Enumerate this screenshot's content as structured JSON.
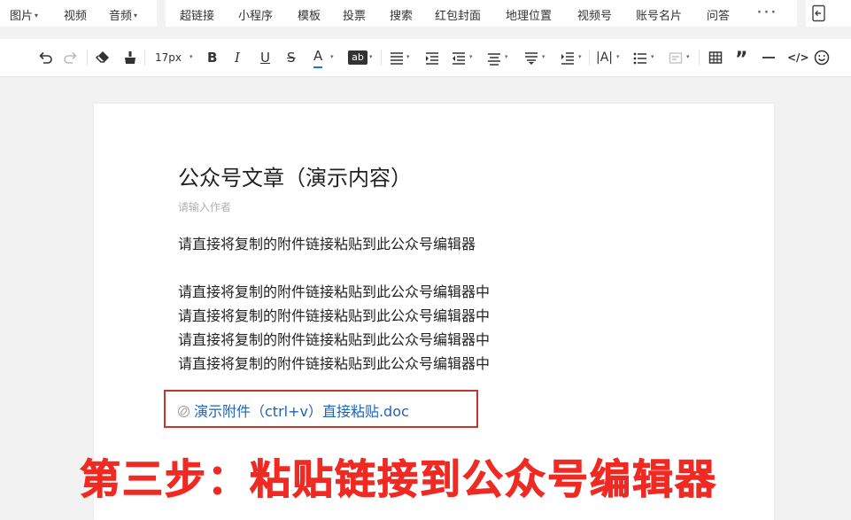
{
  "menubar": {
    "media": [
      {
        "label": "图片",
        "dropdown": true
      },
      {
        "label": "视频",
        "dropdown": false
      },
      {
        "label": "音频",
        "dropdown": true
      }
    ],
    "tools": [
      "超链接",
      "小程序",
      "模板",
      "投票",
      "搜索",
      "红包封面",
      "地理位置",
      "视频号",
      "账号名片",
      "问答"
    ],
    "more_icon": "more-dots-icon",
    "exit_icon": "exit-panel-icon"
  },
  "toolbar": {
    "font_size": "17px",
    "icons": [
      "undo-icon",
      "redo-icon",
      "eraser-icon",
      "format-painter-icon",
      "bold-icon",
      "italic-icon",
      "underline-icon",
      "strikethrough-icon",
      "font-color-icon",
      "highlight-icon",
      "align-icon",
      "indent-icon",
      "outdent-icon",
      "line-spacing-icon",
      "paragraph-spacing-icon",
      "first-line-indent-icon",
      "letter-spacing-icon",
      "list-icon",
      "border-icon",
      "table-icon",
      "quote-icon",
      "divider-icon",
      "code-icon",
      "emoji-icon"
    ],
    "highlight_label": "ab",
    "font_color": "#1a73e8"
  },
  "article": {
    "title": "公众号文章（演示内容）",
    "author_placeholder": "请输入作者",
    "intro": "请直接将复制的附件链接粘贴到此公众号编辑器",
    "lines": [
      "请直接将复制的附件链接粘贴到此公众号编辑器中",
      "请直接将复制的附件链接粘贴到此公众号编辑器中",
      "请直接将复制的附件链接粘贴到此公众号编辑器中",
      "请直接将复制的附件链接粘贴到此公众号编辑器中"
    ],
    "attachment_link": "演示附件（ctrl+v）直接粘贴.doc"
  },
  "overlay": {
    "caption": "第三步：粘贴链接到公众号编辑器"
  },
  "colors": {
    "link": "#1f63b3",
    "highlight_box": "#c0392b",
    "caption": "#ef2a23"
  }
}
